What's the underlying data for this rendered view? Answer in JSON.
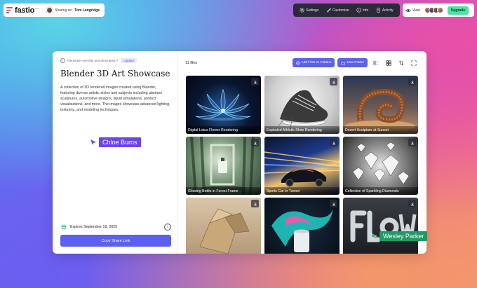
{
  "brand": {
    "name": "fastio",
    "badge": "beta"
  },
  "share": {
    "prefix": "Sharing as:",
    "user": "Tom Langridge"
  },
  "toolbar": {
    "settings": "Settings",
    "customize": "Customize",
    "info": "Info",
    "activity": "Activity"
  },
  "header_right": {
    "view": "View",
    "upgrade": "Upgrade"
  },
  "sidebar": {
    "generate_prompt": "Generate new title and description?",
    "update_label": "Update",
    "title": "Blender 3D Art Showcase",
    "description": "A collection of 3D rendered images created using Blender, featuring diverse artistic styles and subjects including abstract sculptures, automotive designs, liquid simulations, product visualizations, and more. The images showcase advanced lighting, texturing, and modeling techniques.",
    "expires": "Expires September 19, 2025",
    "copy_link": "Copy Share Link"
  },
  "files": {
    "count_label": "11 files",
    "add_label": "Add Files or Folders",
    "new_folder_label": "New Folder",
    "items": [
      {
        "caption": "Digital Lotus Flower Rendering"
      },
      {
        "caption": "Exploded Athletic Shoe Rendering"
      },
      {
        "caption": "Desert Sculpture at Sunset"
      },
      {
        "caption": "Glowing Bottle in Forest Frame"
      },
      {
        "caption": "Sports Car in Tunnel"
      },
      {
        "caption": "Collection of Sparkling Diamonds"
      },
      {
        "caption": ""
      },
      {
        "caption": ""
      },
      {
        "caption": ""
      }
    ]
  },
  "collaborators": {
    "chloe": "Chloe Burns",
    "wesley": "Wesley Parker"
  },
  "colors": {
    "accent": "#5c60f0",
    "chloe": "#6b46e8",
    "wesley": "#1f9a64",
    "upgrade": "#4fe0a4"
  }
}
